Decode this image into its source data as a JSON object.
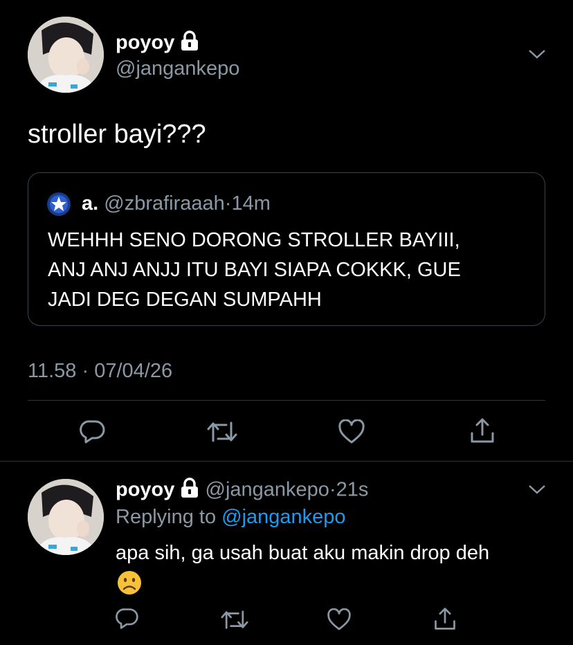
{
  "main_tweet": {
    "display_name": "poyoy",
    "handle": "@jangankepo",
    "text": "stroller bayi???",
    "timestamp": "11.58 · 07/04/26",
    "quoted": {
      "display_name": "a.",
      "handle": "@zbrafiraaah",
      "dot": "·",
      "time": "14m",
      "text_lines": [
        "WEHHH SENO DORONG STROLLER BAYIII,",
        "ANJ ANJ ANJJ ITU BAYI SIAPA COKKK, GUE",
        "JADI DEG DEGAN SUMPAHH"
      ]
    }
  },
  "reply_tweet": {
    "display_name": "poyoy",
    "handle": "@jangankepo",
    "dot": "·",
    "time": "21s",
    "replying_prefix": "Replying to",
    "replying_handle": "@jangankepo",
    "text": "apa sih, ga usah buat aku makin drop deh",
    "emoji": "☹️"
  },
  "colors": {
    "background": "#000000",
    "secondary_text": "#8b98a5",
    "link": "#1d9bf0",
    "divider": "#2f3336"
  },
  "icons": [
    "lock-icon",
    "chevron-down-icon",
    "reply-icon",
    "retweet-icon",
    "like-icon",
    "share-icon",
    "verified-star-icon"
  ]
}
